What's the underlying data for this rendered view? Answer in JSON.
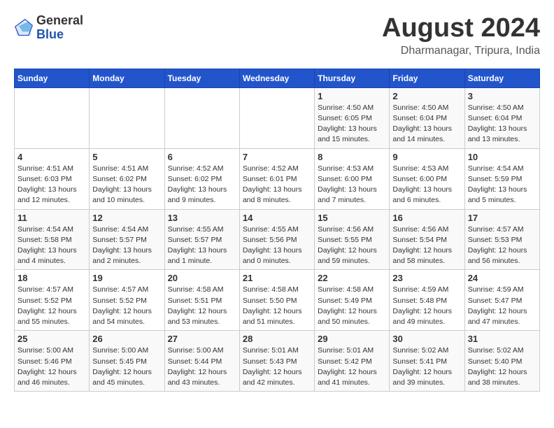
{
  "header": {
    "logo_line1": "General",
    "logo_line2": "Blue",
    "main_title": "August 2024",
    "subtitle": "Dharmanagar, Tripura, India"
  },
  "days_of_week": [
    "Sunday",
    "Monday",
    "Tuesday",
    "Wednesday",
    "Thursday",
    "Friday",
    "Saturday"
  ],
  "weeks": [
    [
      {
        "day": "",
        "info": ""
      },
      {
        "day": "",
        "info": ""
      },
      {
        "day": "",
        "info": ""
      },
      {
        "day": "",
        "info": ""
      },
      {
        "day": "1",
        "info": "Sunrise: 4:50 AM\nSunset: 6:05 PM\nDaylight: 13 hours\nand 15 minutes."
      },
      {
        "day": "2",
        "info": "Sunrise: 4:50 AM\nSunset: 6:04 PM\nDaylight: 13 hours\nand 14 minutes."
      },
      {
        "day": "3",
        "info": "Sunrise: 4:50 AM\nSunset: 6:04 PM\nDaylight: 13 hours\nand 13 minutes."
      }
    ],
    [
      {
        "day": "4",
        "info": "Sunrise: 4:51 AM\nSunset: 6:03 PM\nDaylight: 13 hours\nand 12 minutes."
      },
      {
        "day": "5",
        "info": "Sunrise: 4:51 AM\nSunset: 6:02 PM\nDaylight: 13 hours\nand 10 minutes."
      },
      {
        "day": "6",
        "info": "Sunrise: 4:52 AM\nSunset: 6:02 PM\nDaylight: 13 hours\nand 9 minutes."
      },
      {
        "day": "7",
        "info": "Sunrise: 4:52 AM\nSunset: 6:01 PM\nDaylight: 13 hours\nand 8 minutes."
      },
      {
        "day": "8",
        "info": "Sunrise: 4:53 AM\nSunset: 6:00 PM\nDaylight: 13 hours\nand 7 minutes."
      },
      {
        "day": "9",
        "info": "Sunrise: 4:53 AM\nSunset: 6:00 PM\nDaylight: 13 hours\nand 6 minutes."
      },
      {
        "day": "10",
        "info": "Sunrise: 4:54 AM\nSunset: 5:59 PM\nDaylight: 13 hours\nand 5 minutes."
      }
    ],
    [
      {
        "day": "11",
        "info": "Sunrise: 4:54 AM\nSunset: 5:58 PM\nDaylight: 13 hours\nand 4 minutes."
      },
      {
        "day": "12",
        "info": "Sunrise: 4:54 AM\nSunset: 5:57 PM\nDaylight: 13 hours\nand 2 minutes."
      },
      {
        "day": "13",
        "info": "Sunrise: 4:55 AM\nSunset: 5:57 PM\nDaylight: 13 hours\nand 1 minute."
      },
      {
        "day": "14",
        "info": "Sunrise: 4:55 AM\nSunset: 5:56 PM\nDaylight: 13 hours\nand 0 minutes."
      },
      {
        "day": "15",
        "info": "Sunrise: 4:56 AM\nSunset: 5:55 PM\nDaylight: 12 hours\nand 59 minutes."
      },
      {
        "day": "16",
        "info": "Sunrise: 4:56 AM\nSunset: 5:54 PM\nDaylight: 12 hours\nand 58 minutes."
      },
      {
        "day": "17",
        "info": "Sunrise: 4:57 AM\nSunset: 5:53 PM\nDaylight: 12 hours\nand 56 minutes."
      }
    ],
    [
      {
        "day": "18",
        "info": "Sunrise: 4:57 AM\nSunset: 5:52 PM\nDaylight: 12 hours\nand 55 minutes."
      },
      {
        "day": "19",
        "info": "Sunrise: 4:57 AM\nSunset: 5:52 PM\nDaylight: 12 hours\nand 54 minutes."
      },
      {
        "day": "20",
        "info": "Sunrise: 4:58 AM\nSunset: 5:51 PM\nDaylight: 12 hours\nand 53 minutes."
      },
      {
        "day": "21",
        "info": "Sunrise: 4:58 AM\nSunset: 5:50 PM\nDaylight: 12 hours\nand 51 minutes."
      },
      {
        "day": "22",
        "info": "Sunrise: 4:58 AM\nSunset: 5:49 PM\nDaylight: 12 hours\nand 50 minutes."
      },
      {
        "day": "23",
        "info": "Sunrise: 4:59 AM\nSunset: 5:48 PM\nDaylight: 12 hours\nand 49 minutes."
      },
      {
        "day": "24",
        "info": "Sunrise: 4:59 AM\nSunset: 5:47 PM\nDaylight: 12 hours\nand 47 minutes."
      }
    ],
    [
      {
        "day": "25",
        "info": "Sunrise: 5:00 AM\nSunset: 5:46 PM\nDaylight: 12 hours\nand 46 minutes."
      },
      {
        "day": "26",
        "info": "Sunrise: 5:00 AM\nSunset: 5:45 PM\nDaylight: 12 hours\nand 45 minutes."
      },
      {
        "day": "27",
        "info": "Sunrise: 5:00 AM\nSunset: 5:44 PM\nDaylight: 12 hours\nand 43 minutes."
      },
      {
        "day": "28",
        "info": "Sunrise: 5:01 AM\nSunset: 5:43 PM\nDaylight: 12 hours\nand 42 minutes."
      },
      {
        "day": "29",
        "info": "Sunrise: 5:01 AM\nSunset: 5:42 PM\nDaylight: 12 hours\nand 41 minutes."
      },
      {
        "day": "30",
        "info": "Sunrise: 5:02 AM\nSunset: 5:41 PM\nDaylight: 12 hours\nand 39 minutes."
      },
      {
        "day": "31",
        "info": "Sunrise: 5:02 AM\nSunset: 5:40 PM\nDaylight: 12 hours\nand 38 minutes."
      }
    ]
  ]
}
